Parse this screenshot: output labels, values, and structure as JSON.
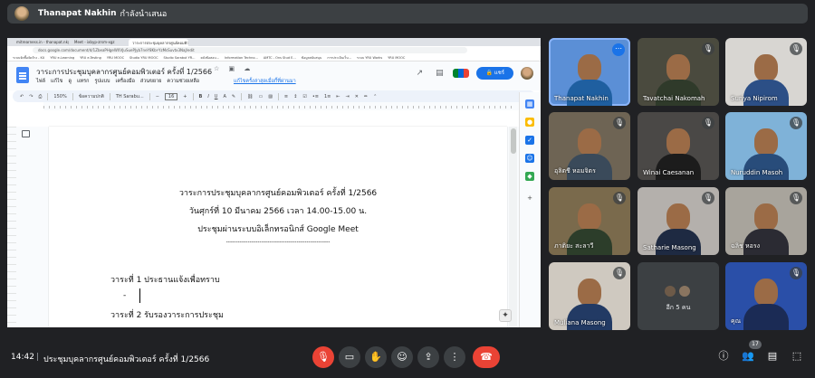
{
  "topbar": {
    "presenter_name": "Thanapat Nakhin",
    "presenter_status": "กำลังนำเสนอ"
  },
  "browser": {
    "tabs": [
      "mitrearness.in - thanapat.nk@ya...",
      "Meet - ixbyp-zrsm-xgz",
      "วาระการประชุมบุคลากรศูนย์คอมพิวเตอร์..."
    ],
    "url": "docs.google.com/document/d/1ZbeaPHgeWXVJuSuePJyb7neY8Kbr-YzMsSuvtx3NaJ/edit",
    "bookmarks": [
      "ระบบจัดซื้อจัดจ้าง - KU",
      "YRU e-Learning",
      "YRU e-Testing",
      "YRU MOOC",
      "Studio YRU MOOC",
      "Studio Sorabut YR...",
      "คลังข้อสอบ...",
      "Information Techno...",
      "AMTC - Ons Stud E...",
      "ข้อมูลสนับสนุน",
      "การประเมินเว็บ...",
      "ระบบ YRU Works",
      "YRU MOOC"
    ]
  },
  "docs": {
    "title": "วาระการประชุมบุคลากรศูนย์คอมพิวเตอร์ ครั้งที่ 1/2566",
    "title_icons": "☆ ▣ ☁",
    "menu": [
      "ไฟล์",
      "แก้ไข",
      "ดู",
      "แทรก",
      "รูปแบบ",
      "เครื่องมือ",
      "ส่วนขยาย",
      "ความช่วยเหลือ"
    ],
    "last_edit": "แก้ไขครั้งล่าสุดเมื่อกี้ที่ผ่านมา",
    "share_label": "แชร์",
    "toolbar": {
      "zoom": "150%",
      "style": "ข้อความปกติ",
      "font": "TH Sarabu...",
      "size": "16"
    },
    "content": {
      "heading1": "วาระการประชุมบุคลากรศูนย์คอมพิวเตอร์ ครั้งที่ 1/2566",
      "heading2": "วันศุกร์ที่ 10 มีนาคม 2566 เวลา 14.00-15.00 น.",
      "heading3": "ประชุมผ่านระบบอิเล็กทรอนิกส์ Google Meet",
      "divider": "-----------------------------------------------------",
      "agenda1": "วาระที่ 1 ประธานแจ้งเพื่อทราบ",
      "agenda1_item": "-",
      "agenda2": "วาระที่ 2 รับรองวาระการประชุม"
    }
  },
  "participants": [
    {
      "name": "Thanapat Nakhin",
      "speaking": true,
      "muted": false
    },
    {
      "name": "Tavatchai Nakomah",
      "muted": true
    },
    {
      "name": "Suriya Nipirom",
      "muted": true
    },
    {
      "name": "อุลิตชี หอมจิตร",
      "muted": true
    },
    {
      "name": "Winai Caesanan",
      "muted": true
    },
    {
      "name": "Nuruddin Masoh",
      "muted": true
    },
    {
      "name": "ภาติยะ สะลาวี",
      "muted": true
    },
    {
      "name": "Satharie Masong",
      "muted": true
    },
    {
      "name": "ฉลิช หอรง",
      "muted": true
    },
    {
      "name": "Muliana Masong",
      "muted": true
    },
    {
      "name": "คุณ",
      "muted": true
    }
  ],
  "others_label": "อีก 5 คน",
  "bottom": {
    "time": "14:42",
    "meeting_title": "ประชุมบุคลากรศูนย์คอมพิวเตอร์ ครั้งที่ 1/2566",
    "participant_count": "17"
  },
  "icons": {
    "mic": "mic-off-icon",
    "camera": "camera-icon",
    "hand": "raise-hand-icon",
    "emoji": "emoji-icon",
    "present": "present-icon",
    "more": "more-vert-icon",
    "end": "end-call-icon"
  },
  "colors": {
    "background": "#202124",
    "end_call": "#ea4335",
    "share_button": "#1a73e8",
    "speaking_outline": "#8ab4f8"
  }
}
